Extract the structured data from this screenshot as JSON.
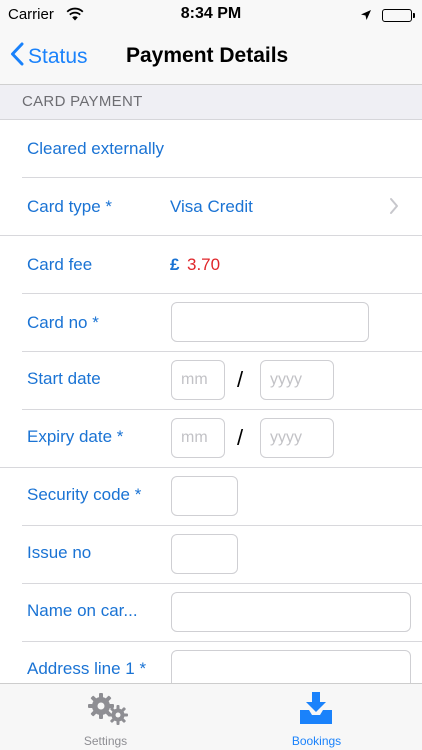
{
  "status_bar": {
    "carrier": "Carrier",
    "time": "8:34 PM"
  },
  "nav": {
    "back_label": "Status",
    "title": "Payment Details"
  },
  "section": {
    "header": "CARD PAYMENT"
  },
  "rows": {
    "cleared": {
      "label": "Cleared externally"
    },
    "card_type": {
      "label": "Card type *",
      "value": "Visa Credit"
    },
    "card_fee": {
      "label": "Card fee",
      "currency": "£",
      "amount": "3.70"
    },
    "card_no": {
      "label": "Card no *",
      "value": ""
    },
    "start_date": {
      "label": "Start date",
      "month_placeholder": "mm",
      "separator": "/",
      "year_placeholder": "yyyy"
    },
    "expiry_date": {
      "label": "Expiry date *",
      "month_placeholder": "mm",
      "separator": "/",
      "year_placeholder": "yyyy"
    },
    "security_code": {
      "label": "Security code *",
      "value": ""
    },
    "issue_no": {
      "label": "Issue no",
      "value": ""
    },
    "name_on_card": {
      "label": "Name on car...",
      "value": ""
    },
    "address_line_1": {
      "label": "Address line 1 *",
      "value": ""
    }
  },
  "tabs": [
    {
      "label": "Settings",
      "icon": "gears-icon",
      "selected": false
    },
    {
      "label": "Bookings",
      "icon": "inbox-download-icon",
      "selected": true
    }
  ],
  "colors": {
    "accent": "#1a82fb",
    "label_blue": "#1a73d4",
    "fee_red": "#e0262a",
    "tab_inactive": "#8e8e93"
  }
}
